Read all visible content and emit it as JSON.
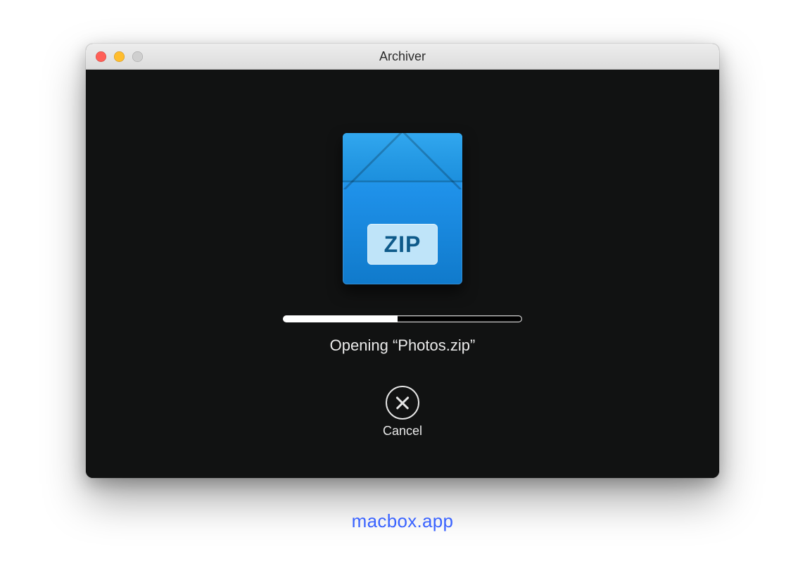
{
  "window": {
    "title": "Archiver"
  },
  "icon": {
    "badge_text": "ZIP"
  },
  "progress": {
    "percent": 48
  },
  "status": {
    "text": "Opening “Photos.zip”"
  },
  "cancel": {
    "label": "Cancel"
  },
  "watermark": {
    "text": "macbox.app"
  }
}
